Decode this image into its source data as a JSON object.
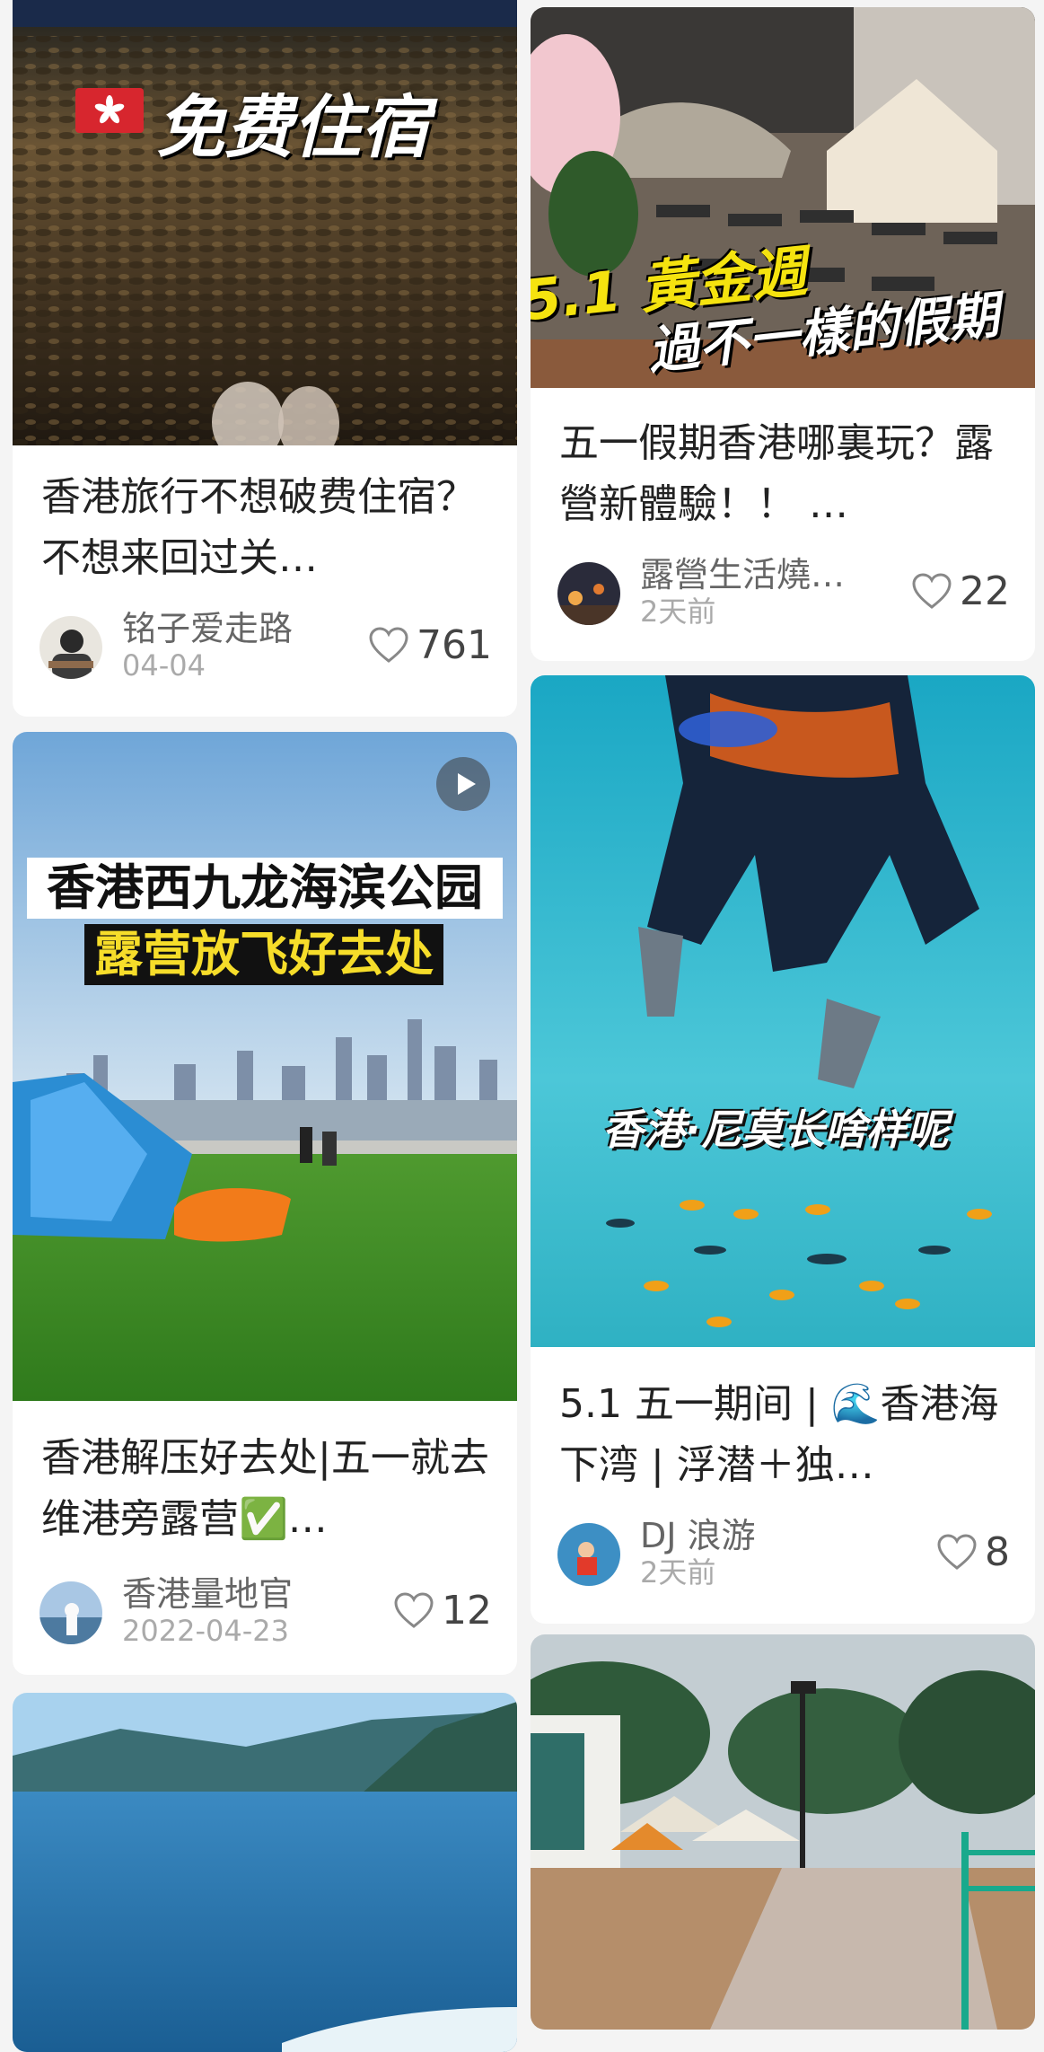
{
  "colors": {
    "page_bg": "#f4f4f4",
    "card_bg": "#ffffff",
    "title_text": "#222222",
    "author_text": "#666666",
    "date_text": "#aaaaaa"
  },
  "feed": {
    "left": [
      {
        "cover_overlay": "免费住宿",
        "title": "香港旅行不想破费住宿？不想来回过关…",
        "author": "铭子爱走路",
        "date": "04-04",
        "likes": "761",
        "icon": "heart-outline-icon"
      },
      {
        "cover_overlay_line1": "香港西九龙海滨公园",
        "cover_overlay_line2": "露营放飞好去处",
        "is_video": true,
        "title": "香港解压好去处|五一就去维港旁露营✅…",
        "author": "香港量地官",
        "date": "2022-04-23",
        "likes": "12",
        "icon": "heart-outline-icon"
      },
      {
        "cover_overlay": ""
      }
    ],
    "right": [
      {
        "cover_overlay_line1": "5.1 黃金週",
        "cover_overlay_line2": "過不一樣的假期",
        "title": "五一假期香港哪裏玩？露營新體驗！！ …",
        "author": "露營生活燒…",
        "date": "2天前",
        "likes": "22",
        "icon": "heart-outline-icon"
      },
      {
        "cover_overlay": "香港·尼莫长啥样呢",
        "title": "5.1 五一期间 | 🌊香港海下湾 | 浮潜＋独…",
        "author": "DJ 浪游",
        "date": "2天前",
        "likes": "8",
        "icon": "heart-outline-icon"
      },
      {
        "cover_overlay": ""
      }
    ]
  }
}
